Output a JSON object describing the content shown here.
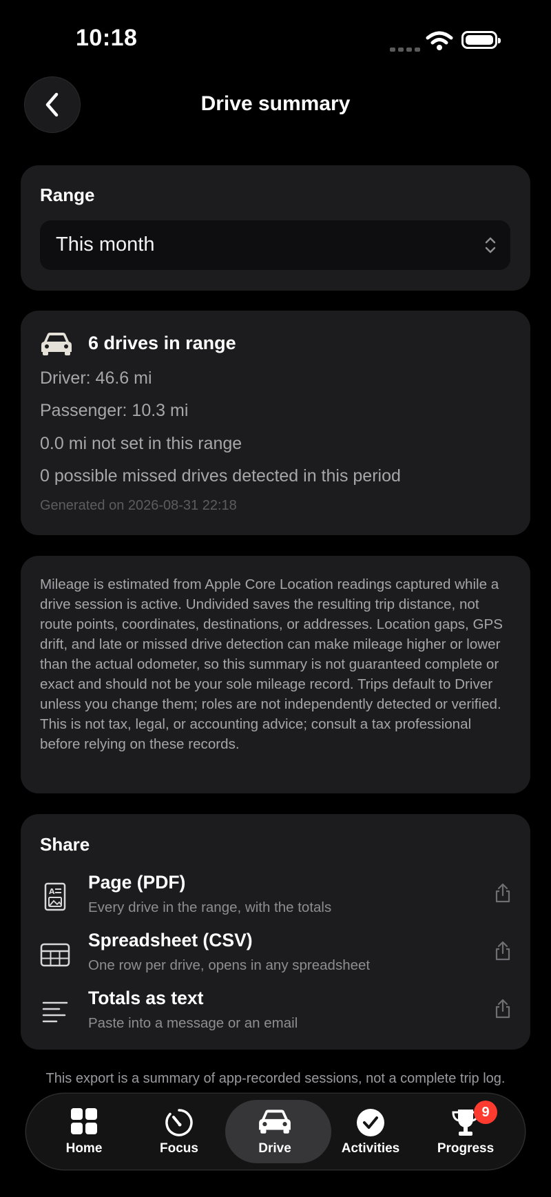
{
  "status_bar": {
    "time": "10:18"
  },
  "header": {
    "title": "Drive summary"
  },
  "range": {
    "label": "Range",
    "selected": "This month"
  },
  "summary": {
    "title": "6 drives in range",
    "driver": "Driver: 46.6 mi",
    "passenger": "Passenger: 10.3 mi",
    "not_set": "0.0 mi not set in this range",
    "missed": "0 possible missed drives detected in this period",
    "generated": "Generated on 2026-08-31 22:18"
  },
  "disclaimer": "Mileage is estimated from Apple Core Location readings captured while a drive session is active. Undivided saves the resulting trip distance, not route points, coordinates, destinations, or addresses. Location gaps, GPS drift, and late or missed drive detection can make mileage higher or lower than the actual odometer, so this summary is not guaranteed complete or exact and should not be your sole mileage record. Trips default to Driver unless you change them; roles are not independently detected or verified. This is not tax, legal, or accounting advice; consult a tax professional before relying on these records.",
  "share": {
    "label": "Share",
    "items": [
      {
        "title": "Page (PDF)",
        "subtitle": "Every drive in the range, with the totals",
        "icon": "pdf-document-icon"
      },
      {
        "title": "Spreadsheet (CSV)",
        "subtitle": "One row per drive, opens in any spreadsheet",
        "icon": "table-grid-icon"
      },
      {
        "title": "Totals as text",
        "subtitle": "Paste into a message or an email",
        "icon": "text-lines-icon"
      }
    ]
  },
  "footer_note": "This export is a summary of app-recorded sessions, not a complete trip log.",
  "tabs": [
    {
      "label": "Home",
      "icon": "grid-icon"
    },
    {
      "label": "Focus",
      "icon": "timer-icon"
    },
    {
      "label": "Drive",
      "icon": "car-icon",
      "active": true
    },
    {
      "label": "Activities",
      "icon": "checkmark-circle-icon"
    },
    {
      "label": "Progress",
      "icon": "trophy-icon",
      "badge": "9"
    }
  ],
  "colors": {
    "background": "#000000",
    "card": "#1c1c1e",
    "badge": "#ff3b30",
    "active_tab": "#363638"
  }
}
